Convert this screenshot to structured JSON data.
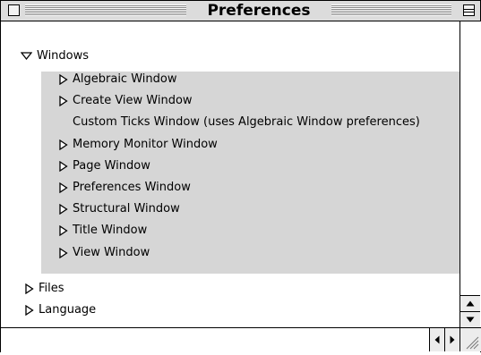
{
  "window": {
    "title": "Preferences"
  },
  "tree": {
    "windows": {
      "label": "Windows",
      "children": [
        {
          "label": "Algebraic Window",
          "expandable": true
        },
        {
          "label": "Create View Window",
          "expandable": true
        },
        {
          "label": "Custom Ticks Window (uses Algebraic Window preferences)",
          "expandable": false
        },
        {
          "label": "Memory Monitor Window",
          "expandable": true
        },
        {
          "label": "Page Window",
          "expandable": true
        },
        {
          "label": "Preferences Window",
          "expandable": true
        },
        {
          "label": "Structural Window",
          "expandable": true
        },
        {
          "label": "Title Window",
          "expandable": true
        },
        {
          "label": "View Window",
          "expandable": true
        }
      ]
    },
    "files": {
      "label": "Files"
    },
    "language": {
      "label": "Language"
    }
  },
  "colors": {
    "group_background": "#d6d6d6",
    "title_bar": "#dcdcdc",
    "border": "#000000"
  },
  "icons": {
    "collapsed": "triangle-right-icon",
    "expanded": "triangle-down-icon",
    "close": "close-box-icon",
    "zoom": "zoom-box-icon",
    "scroll_up": "scroll-up-arrow-icon",
    "scroll_down": "scroll-down-arrow-icon",
    "scroll_left": "scroll-left-arrow-icon",
    "scroll_right": "scroll-right-arrow-icon",
    "grow": "grow-box-icon"
  }
}
